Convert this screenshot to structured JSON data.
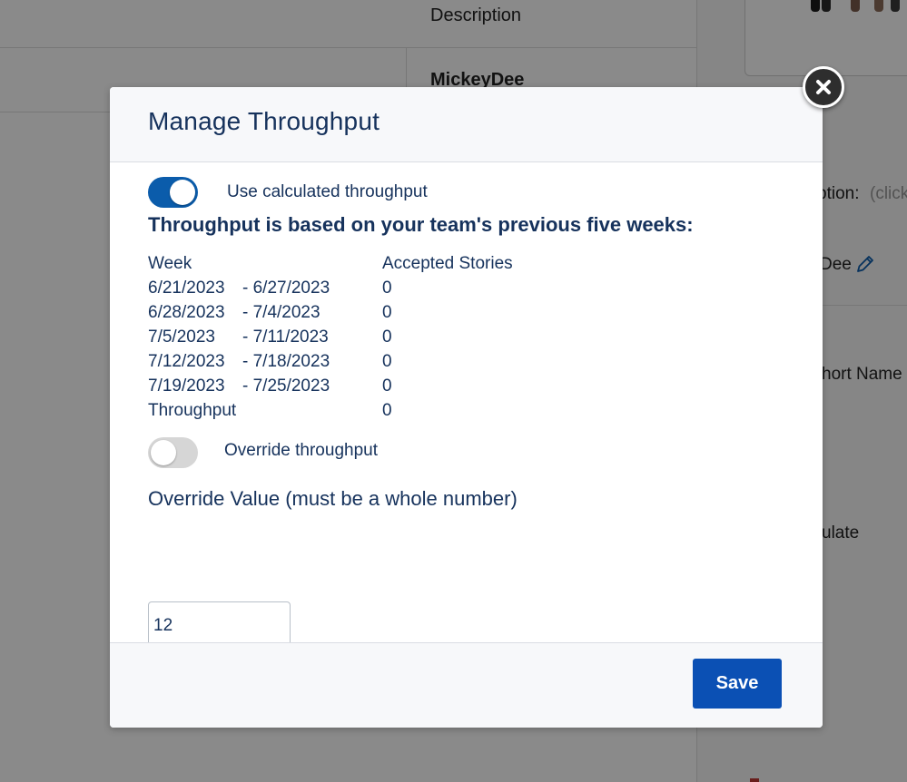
{
  "background": {
    "column_header": "Description",
    "row_value": "MickeyDee",
    "right_panel": {
      "option_label": "ption:",
      "option_hint": "(click",
      "owner_value": "Dee",
      "short_name_label": "hort Name",
      "calculate_label": "ulate"
    }
  },
  "modal": {
    "title": "Manage Throughput",
    "use_calculated": {
      "label": "Use calculated throughput",
      "enabled": true
    },
    "based_on_heading": "Throughput is based on your team's previous five weeks:",
    "table": {
      "headers": [
        "Week",
        "Accepted Stories"
      ],
      "rows": [
        {
          "start": "6/21/2023",
          "end": "- 6/27/2023",
          "accepted": "0"
        },
        {
          "start": "6/28/2023",
          "end": "- 7/4/2023",
          "accepted": "0"
        },
        {
          "start": "7/5/2023",
          "end": "- 7/11/2023",
          "accepted": "0"
        },
        {
          "start": "7/12/2023",
          "end": "- 7/18/2023",
          "accepted": "0"
        },
        {
          "start": "7/19/2023",
          "end": "- 7/25/2023",
          "accepted": "0"
        }
      ],
      "total_label": "Throughput",
      "total_value": "0"
    },
    "override": {
      "label": "Override throughput",
      "enabled": false
    },
    "override_value_heading": "Override Value (must be a whole number)",
    "override_value": "12",
    "save_label": "Save"
  },
  "colors": {
    "primary": "#0b5cab",
    "save_button": "#0b50b4",
    "text": "#16325c"
  },
  "icons": {
    "close": "close-icon",
    "edit": "pencil-icon"
  }
}
